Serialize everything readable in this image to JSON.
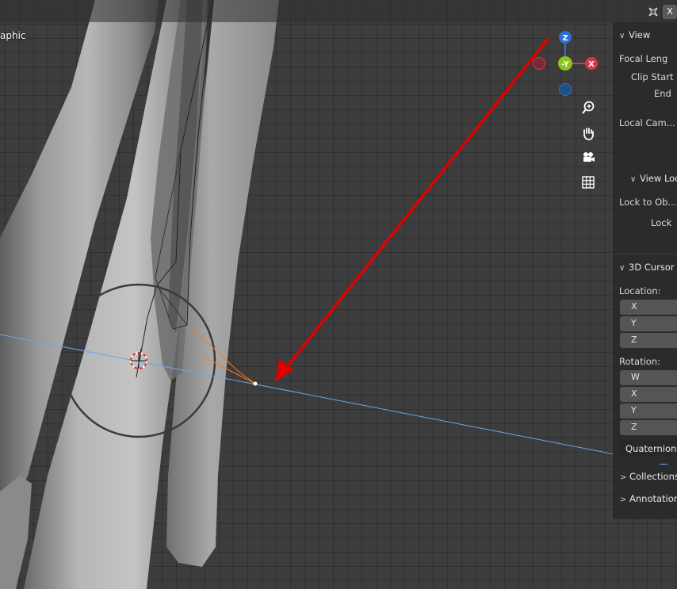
{
  "viewport": {
    "view_label": "aphic"
  },
  "gizmo": {
    "z_label": "Z",
    "y_label": "-Y",
    "x_label": "X",
    "colors": {
      "z": "#2f6ed1",
      "y": "#8bc41a",
      "x": "#d9354d"
    }
  },
  "nav_buttons": [
    {
      "icon": "zoom-icon"
    },
    {
      "icon": "hand-icon"
    },
    {
      "icon": "camera-icon"
    },
    {
      "icon": "grid-icon"
    }
  ],
  "header": {
    "close_label": "X"
  },
  "sidebar": {
    "view_section": {
      "title": "View",
      "focal_length_label": "Focal Leng",
      "clip_start_label": "Clip Start",
      "clip_end_label": "End",
      "local_camera_label": "Local Cam..."
    },
    "view_lock_section": {
      "title": "View Loc",
      "lock_to_object_label": "Lock to Ob...",
      "lock_label": "Lock"
    },
    "cursor_section": {
      "title": "3D Cursor",
      "location_label": "Location:",
      "location_axes": [
        "X",
        "Y",
        "Z"
      ],
      "rotation_label": "Rotation:",
      "rotation_axes": [
        "W",
        "X",
        "Y",
        "Z"
      ],
      "rotation_mode": "Quaternion"
    },
    "collections_label": "Collections",
    "annotations_label": "Annotation"
  },
  "accent_colors": {
    "arrow": "#e00000",
    "normal_line": "#6aa6e8",
    "selection": "#ff7a1a"
  }
}
